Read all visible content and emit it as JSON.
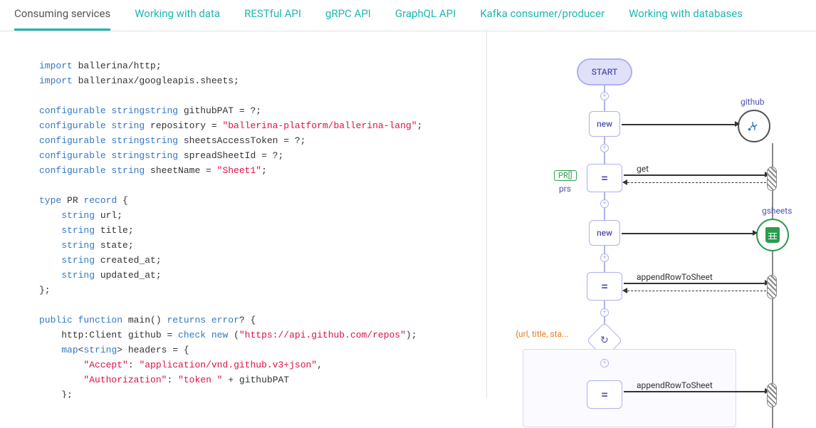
{
  "tabs": [
    {
      "label": "Consuming services",
      "active": true
    },
    {
      "label": "Working with data"
    },
    {
      "label": "RESTful API"
    },
    {
      "label": "gRPC API"
    },
    {
      "label": "GraphQL API"
    },
    {
      "label": "Kafka consumer/producer"
    },
    {
      "label": "Working with databases"
    }
  ],
  "code": [
    {
      "kw": "import",
      "rest": " ballerina/http;"
    },
    {
      "kw": "import",
      "rest": " ballerinax/googleapis.sheets;"
    },
    {
      "blank": true
    },
    {
      "kw": "configurable ",
      "typ": "string",
      "rest": " githubPAT = ?;"
    },
    {
      "kw": "configurable ",
      "typ": "string",
      "plain1": " repository = ",
      "str": "\"ballerina-platform/ballerina-lang\"",
      "plain2": ";"
    },
    {
      "kw": "configurable ",
      "typ": "string",
      "rest": " sheetsAccessToken = ?;"
    },
    {
      "kw": "configurable ",
      "typ": "string",
      "rest": " spreadSheetId = ?;"
    },
    {
      "kw": "configurable ",
      "typ": "string",
      "plain1": " sheetName = ",
      "str": "\"Sheet1\"",
      "plain2": ";"
    },
    {
      "blank": true
    },
    {
      "kw": "type",
      "plain1": " PR ",
      "kw2": "record",
      "plain2": " {"
    },
    {
      "indent": 1,
      "typ": "string",
      "rest": " url;"
    },
    {
      "indent": 1,
      "typ": "string",
      "rest": " title;"
    },
    {
      "indent": 1,
      "typ": "string",
      "rest": " state;"
    },
    {
      "indent": 1,
      "typ": "string",
      "rest": " created_at;"
    },
    {
      "indent": 1,
      "typ": "string",
      "rest": " updated_at;"
    },
    {
      "plain": "};"
    },
    {
      "blank": true
    },
    {
      "kw": "public ",
      "kw2": "function",
      "plain1": " main() ",
      "kw3": "returns ",
      "typ": "error",
      "plain2": "? {"
    },
    {
      "indent": 1,
      "plain1": "http:Client github = ",
      "kw": "check ",
      "kw2": "new",
      "plain2": " (",
      "str": "\"https://api.github.com/repos\"",
      "plain3": ");"
    },
    {
      "indent": 1,
      "typ": "map",
      "plain1": "<",
      "typ2": "string",
      "plain2": "> headers = {"
    },
    {
      "indent": 2,
      "str": "\"Accept\"",
      "plain1": ": ",
      "str2": "\"application/vnd.github.v3+json\"",
      "plain2": ","
    },
    {
      "indent": 2,
      "str": "\"Authorization\"",
      "plain1": ": ",
      "str2": "\"token \"",
      "plain2": " + githubPAT"
    },
    {
      "indent": 1,
      "plain": "};"
    }
  ],
  "diagram": {
    "start": "START",
    "node_new": "new",
    "node_eq": "=",
    "label_github": "github",
    "label_gsheets": "gsheets",
    "label_get": "get",
    "label_append": "appendRowToSheet",
    "prs_tag": "PR[]",
    "prs_text": "prs",
    "loop_label": "{url, title, sta..."
  }
}
